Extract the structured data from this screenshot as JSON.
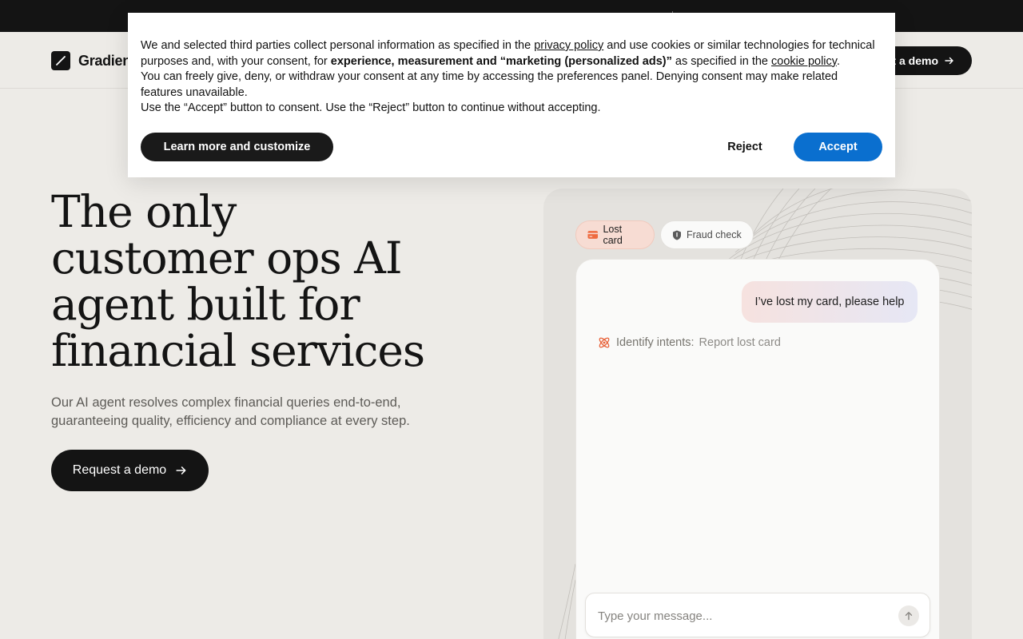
{
  "nav": {
    "brand": "Gradient",
    "cta_label": "Request a demo",
    "cta_visible": "st a demo"
  },
  "hero": {
    "title_lines": [
      "The only",
      "customer ops AI",
      "agent built for",
      "financial services"
    ],
    "subtitle_lines": [
      "Our AI agent resolves complex financial queries end-to-end,",
      "guaranteeing quality, efficiency and compliance at every step."
    ],
    "cta_label": "Request a demo"
  },
  "demo": {
    "chips": [
      {
        "label": "Lost card",
        "icon": "card-icon",
        "active": true
      },
      {
        "label": "Fraud check",
        "icon": "shield-icon",
        "active": false
      }
    ],
    "user_message": "I’ve lost my card, please help",
    "intent_label": "Identify intents:",
    "intent_value": "Report lost card",
    "input_placeholder": "Type your message..."
  },
  "consent": {
    "p1_a": "We and selected third parties collect personal information as specified in the ",
    "privacy_link": "privacy policy",
    "p1_b": " and use cookies or similar technologies for technical purposes and, with your consent, for ",
    "p1_bold": "experience, measurement and “marketing (personalized ads)”",
    "p1_c": " as specified in the ",
    "cookie_link": "cookie policy",
    "p1_d": ".",
    "p2": "You can freely give, deny, or withdraw your consent at any time by accessing the preferences panel. Denying consent may make related features unavailable.",
    "p3": "Use the “Accept” button to consent. Use the “Reject” button to continue without accepting.",
    "learn_label": "Learn more and customize",
    "reject_label": "Reject",
    "accept_label": "Accept"
  },
  "colors": {
    "dark": "#141414",
    "page_bg": "#edebe7",
    "accept_blue": "#0a6fcf",
    "chip_active_bg": "#f7dcd3",
    "intent_icon": "#e8623a"
  }
}
